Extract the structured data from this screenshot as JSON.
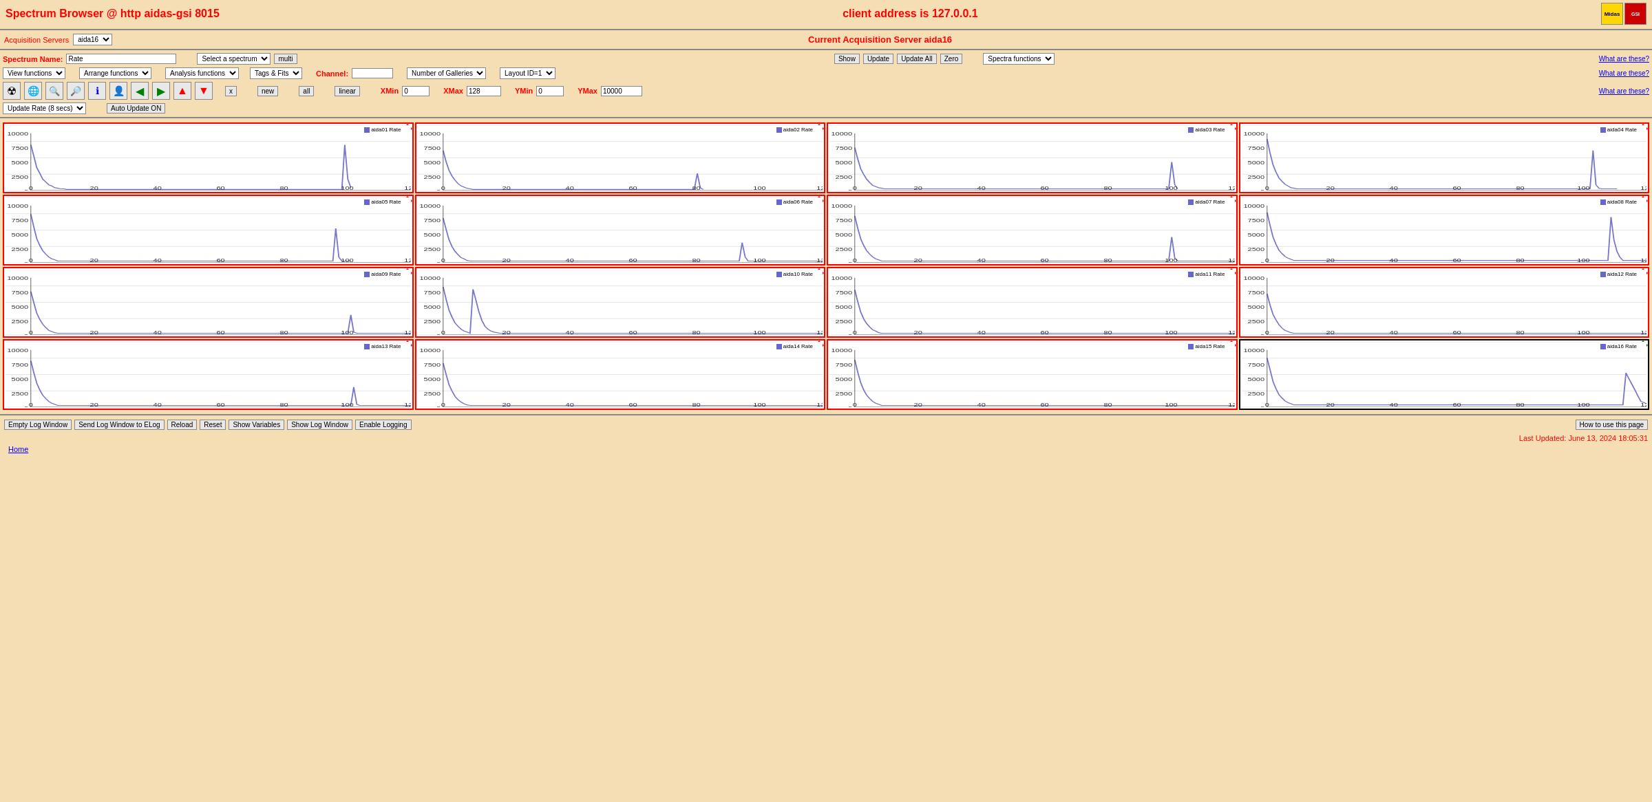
{
  "header": {
    "title": "Spectrum Browser @ http aidas-gsi 8015",
    "client": "client address is 127.0.0.1"
  },
  "acq_servers": {
    "label": "Acquisition Servers",
    "selected": "aida16",
    "options": [
      "aida16"
    ]
  },
  "current_server": "Current Acquisition Server aida16",
  "spectrum_name": {
    "label": "Spectrum Name:",
    "value": "Rate"
  },
  "select_spectrum": {
    "label": "Select a spectrum",
    "options": [
      "Select a spectrum"
    ]
  },
  "multi_button": "multi",
  "show_button": "Show",
  "update_button": "Update",
  "update_all_button": "Update All",
  "zero_button": "Zero",
  "spectra_functions": {
    "label": "Spectra functions",
    "options": [
      "Spectra functions"
    ]
  },
  "what_are_these_1": "What are these?",
  "what_are_these_2": "What are these?",
  "what_are_these_3": "What are these?",
  "view_functions": {
    "label": "View functions",
    "options": [
      "View functions"
    ]
  },
  "arrange_functions": {
    "label": "Arrange functions",
    "options": [
      "Arrange functions"
    ]
  },
  "analysis_functions": {
    "label": "Analysis functions",
    "options": [
      "Analysis functions"
    ]
  },
  "tags_fits": {
    "label": "Tags & Fits",
    "options": [
      "Tags & Fits"
    ]
  },
  "channel_label": "Channel:",
  "channel_value": "",
  "number_of_galleries": {
    "label": "Number of Galleries",
    "options": [
      "Number of Galleries"
    ]
  },
  "layout_id": {
    "label": "Layout ID=1",
    "options": [
      "Layout ID=1"
    ]
  },
  "x_button": "x",
  "new_button": "new",
  "all_button": "all",
  "linear_button": "linear",
  "xmin_label": "XMin",
  "xmin_value": "0",
  "xmax_label": "XMax",
  "xmax_value": "128",
  "ymin_label": "YMin",
  "ymin_value": "0",
  "ymax_label": "YMax",
  "ymax_value": "10000",
  "update_rate": {
    "label": "Update Rate (8 secs)",
    "options": [
      "Update Rate (8 secs)"
    ]
  },
  "auto_update": "Auto Update ON",
  "galleries": [
    {
      "id": "aida01",
      "label": "aida01 Rate",
      "indicator": "red"
    },
    {
      "id": "aida02",
      "label": "aida02 Rate",
      "indicator": "red"
    },
    {
      "id": "aida03",
      "label": "aida03 Rate",
      "indicator": "red"
    },
    {
      "id": "aida04",
      "label": "aida04 Rate",
      "indicator": "red"
    },
    {
      "id": "aida05",
      "label": "aida05 Rate",
      "indicator": "red"
    },
    {
      "id": "aida06",
      "label": "aida06 Rate",
      "indicator": "red"
    },
    {
      "id": "aida07",
      "label": "aida07 Rate",
      "indicator": "red"
    },
    {
      "id": "aida08",
      "label": "aida08 Rate",
      "indicator": "red"
    },
    {
      "id": "aida09",
      "label": "aida09 Rate",
      "indicator": "red"
    },
    {
      "id": "aida10",
      "label": "aida10 Rate",
      "indicator": "red"
    },
    {
      "id": "aida11",
      "label": "aida11 Rate",
      "indicator": "red"
    },
    {
      "id": "aida12",
      "label": "aida12 Rate",
      "indicator": "red"
    },
    {
      "id": "aida13",
      "label": "aida13 Rate",
      "indicator": "red"
    },
    {
      "id": "aida14",
      "label": "aida14 Rate",
      "indicator": "red"
    },
    {
      "id": "aida15",
      "label": "aida15 Rate",
      "indicator": "red"
    },
    {
      "id": "aida16",
      "label": "aida16 Rate",
      "indicator": "green"
    }
  ],
  "bottom_buttons": [
    "Empty Log Window",
    "Send Log Window to ELog",
    "Reload",
    "Reset",
    "Show Variables",
    "Show Log Window",
    "Enable Logging"
  ],
  "how_to_use": "How to use this page",
  "last_updated": "Last Updated: June 13, 2024 18:05:31",
  "home_link": "Home"
}
